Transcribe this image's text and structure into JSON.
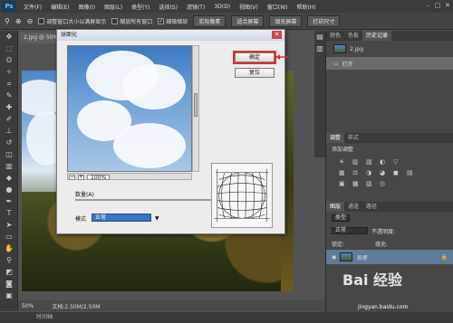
{
  "app": {
    "logo": "Ps",
    "menus": [
      "文件(F)",
      "编辑(E)",
      "图像(I)",
      "图层(L)",
      "类型(Y)",
      "选择(S)",
      "滤镜(T)",
      "3D(D)",
      "视图(V)",
      "窗口(W)",
      "帮助(H)"
    ]
  },
  "options_bar": {
    "zoom_icons": [
      "⊕",
      "⊖"
    ],
    "checks": [
      {
        "label": "调整窗口大小以满屏显示",
        "checked": false
      },
      {
        "label": "缩放所有窗口",
        "checked": false
      },
      {
        "label": "细微缩放",
        "checked": true
      }
    ],
    "buttons": [
      "实际像素",
      "适合屏幕",
      "填充屏幕",
      "打印尺寸"
    ]
  },
  "document": {
    "tab_label": "2.jpg @ 50%",
    "zoom": "50%",
    "doc_info": "文档:2.50M/2.50M",
    "timeline": "时间轴"
  },
  "dialog": {
    "title": "球面化",
    "ok_label": "确定",
    "reset_label": "复位",
    "zoom_value": "100%",
    "amount_label": "数量(A)",
    "amount_value": "100",
    "amount_unit": "%",
    "mode_label": "模式",
    "mode_value": "正常",
    "amount_fraction": 1.0
  },
  "panels": {
    "top_tabs": [
      "颜色",
      "色板",
      "历史记录"
    ],
    "history": [
      {
        "label": "2.jpg"
      },
      {
        "label": "打开"
      }
    ],
    "adjust_tabs": [
      "调整",
      "样式"
    ],
    "adjust_title": "添加调整",
    "adjust_icons": [
      "☀",
      "▥",
      "▧",
      "◐",
      "▽",
      "",
      "▦",
      "⚖",
      "◑",
      "◕",
      "◼",
      "▤",
      "▣",
      "▩",
      "▨",
      "◎"
    ],
    "layer_tabs": [
      "图层",
      "通道",
      "路径"
    ],
    "kind": "类型",
    "blend": "正常",
    "opacity": "不透明度:",
    "lock": "锁定:",
    "fill": "填充:",
    "layers": [
      {
        "name": "背景"
      }
    ]
  },
  "watermark": {
    "text": "Bai 经验",
    "url": "jingyan.baidu.com"
  },
  "colors": {
    "ok_highlight": "#e03030",
    "mode_select": "#3a74c4",
    "layer_selected": "#607a99"
  }
}
